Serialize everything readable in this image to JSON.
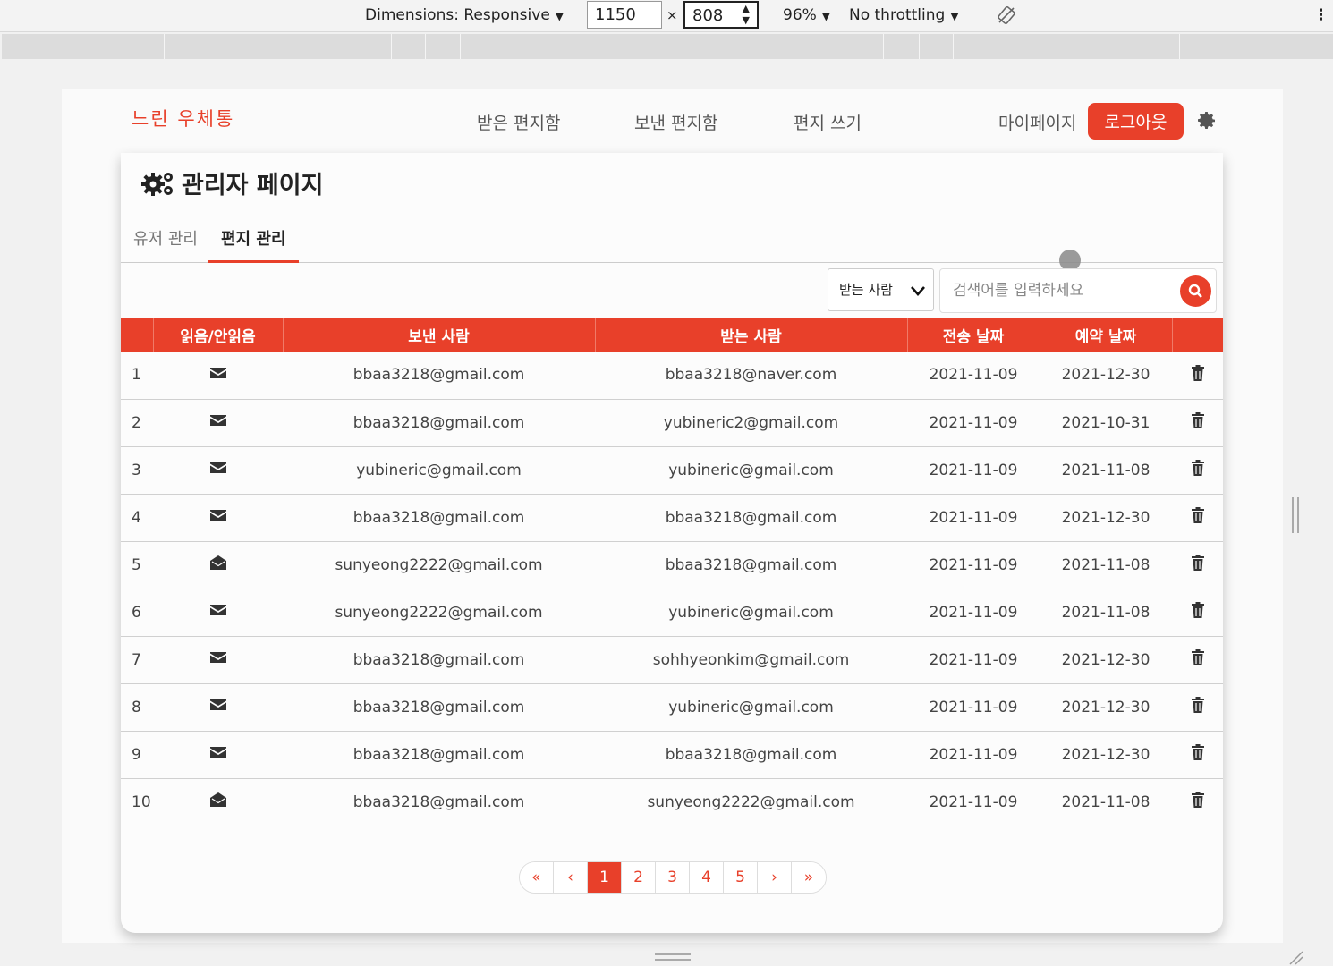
{
  "devtools": {
    "dimensions_label": "Dimensions: Responsive",
    "width": "1150",
    "height": "808",
    "zoom": "96%",
    "throttling": "No throttling"
  },
  "header": {
    "logo": "느린 우체통",
    "nav": [
      "받은 편지함",
      "보낸 편지함",
      "편지 쓰기"
    ],
    "mypage": "마이페이지",
    "logout": "로그아웃"
  },
  "admin": {
    "title": "관리자 페이지",
    "tabs": [
      {
        "label": "유저 관리",
        "active": false
      },
      {
        "label": "편지 관리",
        "active": true
      }
    ],
    "filter_selected": "받는 사람",
    "search_placeholder": "검색어를 입력하세요"
  },
  "table": {
    "headers": [
      "",
      "읽음/안읽음",
      "보낸 사람",
      "받는 사람",
      "전송 날짜",
      "예약 날짜",
      ""
    ],
    "rows": [
      {
        "no": "1",
        "read": false,
        "sender": "bbaa3218@gmail.com",
        "receiver": "bbaa3218@naver.com",
        "sent": "2021-11-09",
        "reserved": "2021-12-30"
      },
      {
        "no": "2",
        "read": false,
        "sender": "bbaa3218@gmail.com",
        "receiver": "yubineric2@gmail.com",
        "sent": "2021-11-09",
        "reserved": "2021-10-31"
      },
      {
        "no": "3",
        "read": false,
        "sender": "yubineric@gmail.com",
        "receiver": "yubineric@gmail.com",
        "sent": "2021-11-09",
        "reserved": "2021-11-08"
      },
      {
        "no": "4",
        "read": false,
        "sender": "bbaa3218@gmail.com",
        "receiver": "bbaa3218@gmail.com",
        "sent": "2021-11-09",
        "reserved": "2021-12-30"
      },
      {
        "no": "5",
        "read": true,
        "sender": "sunyeong2222@gmail.com",
        "receiver": "bbaa3218@gmail.com",
        "sent": "2021-11-09",
        "reserved": "2021-11-08"
      },
      {
        "no": "6",
        "read": false,
        "sender": "sunyeong2222@gmail.com",
        "receiver": "yubineric@gmail.com",
        "sent": "2021-11-09",
        "reserved": "2021-11-08"
      },
      {
        "no": "7",
        "read": false,
        "sender": "bbaa3218@gmail.com",
        "receiver": "sohhyeonkim@gmail.com",
        "sent": "2021-11-09",
        "reserved": "2021-12-30"
      },
      {
        "no": "8",
        "read": false,
        "sender": "bbaa3218@gmail.com",
        "receiver": "yubineric@gmail.com",
        "sent": "2021-11-09",
        "reserved": "2021-12-30"
      },
      {
        "no": "9",
        "read": false,
        "sender": "bbaa3218@gmail.com",
        "receiver": "bbaa3218@gmail.com",
        "sent": "2021-11-09",
        "reserved": "2021-12-30"
      },
      {
        "no": "10",
        "read": true,
        "sender": "bbaa3218@gmail.com",
        "receiver": "sunyeong2222@gmail.com",
        "sent": "2021-11-09",
        "reserved": "2021-11-08"
      }
    ]
  },
  "pagination": {
    "first": "«",
    "prev": "‹",
    "pages": [
      "1",
      "2",
      "3",
      "4",
      "5"
    ],
    "current": "1",
    "next": "›",
    "last": "»"
  },
  "colors": {
    "accent": "#e8402a"
  }
}
